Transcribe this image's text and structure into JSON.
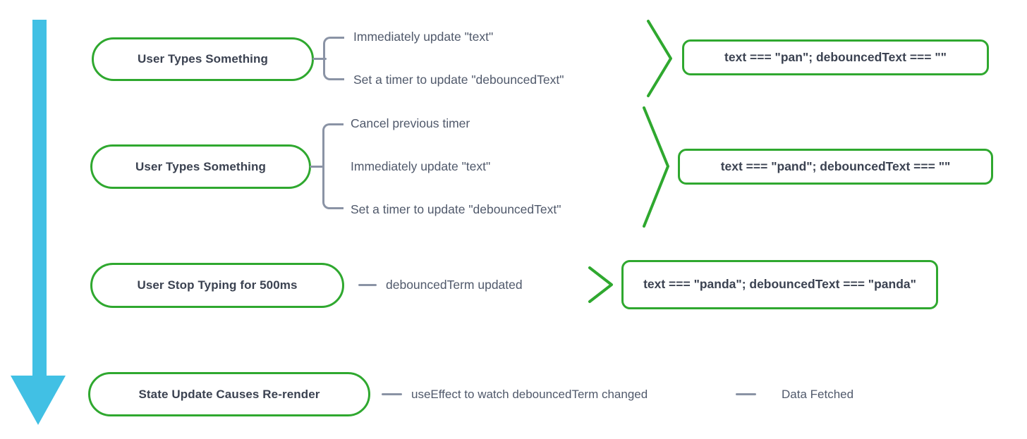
{
  "diagram": {
    "title": "Debounce flow diagram",
    "colors": {
      "node_border": "#2fa82f",
      "chevron": "#2fa82f",
      "connector": "#8a93a5",
      "arrow": "#41c0e4",
      "text": "#3b4251",
      "label_text": "#50596b",
      "background": "#ffffff"
    },
    "flow_arrow": {
      "direction": "down",
      "label": "time-flow-arrow"
    },
    "rows": [
      {
        "node": "User Types Something",
        "branches": [
          "Immediately update \"text\"",
          "Set a timer to update \"debouncedText\""
        ],
        "result": "text === \"pan\"; debouncedText === \"\""
      },
      {
        "node": "User Types Something",
        "branches": [
          "Cancel previous timer",
          "Immediately update \"text\"",
          "Set a timer to update \"debouncedText\""
        ],
        "result": "text === \"pand\"; debouncedText === \"\""
      },
      {
        "node": "User Stop Typing for 500ms",
        "branches": [
          "debouncedTerm updated"
        ],
        "result": "text === \"panda\"; debouncedText === \"panda\""
      },
      {
        "node": "State Update Causes Re-render",
        "branches": [
          "useEffect to watch debouncedTerm changed",
          "Data Fetched"
        ],
        "result": ""
      }
    ]
  }
}
